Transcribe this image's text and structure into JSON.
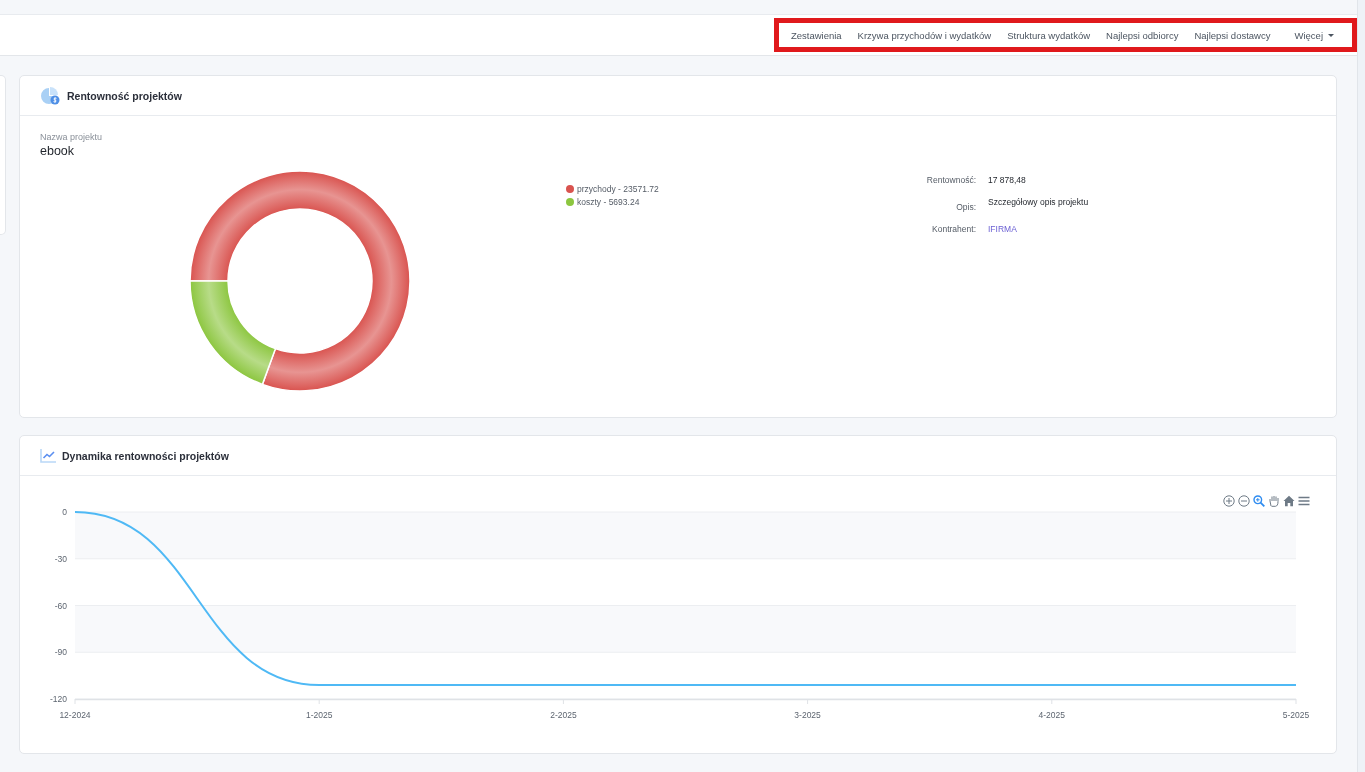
{
  "nav": {
    "highlighted": true,
    "items": [
      {
        "label": "Zestawienia",
        "dropdown": false
      },
      {
        "label": "Krzywa przychodów i wydatków",
        "dropdown": false
      },
      {
        "label": "Struktura wydatków",
        "dropdown": false
      },
      {
        "label": "Najlepsi odbiorcy",
        "dropdown": false
      },
      {
        "label": "Najlepsi dostawcy",
        "dropdown": false
      },
      {
        "label": "Więcej",
        "dropdown": true
      }
    ]
  },
  "profitability_card": {
    "title": "Rentowność projektów",
    "project_label": "Nazwa projektu",
    "project_name": "ebook",
    "legend": [
      {
        "label": "przychody - 23571.72",
        "color": "#d9534f"
      },
      {
        "label": "koszty - 5693.24",
        "color": "#8cc63f"
      }
    ],
    "chart_data": {
      "type": "donut",
      "values": [
        80.55,
        19.45
      ]
    },
    "details": [
      {
        "label": "Rentowność:",
        "value": "17 878,48",
        "kind": "text"
      },
      {
        "label": "Opis:",
        "value": "Szczegółowy opis projektu",
        "kind": "text"
      },
      {
        "label": "Kontrahent:",
        "value": "IFIRMA",
        "kind": "link"
      }
    ]
  },
  "dynamics_card": {
    "title": "Dynamika rentowności projektów",
    "toolbar": [
      {
        "kind": "zoom-in",
        "selected": false
      },
      {
        "kind": "zoom-out",
        "selected": false
      },
      {
        "kind": "zoom",
        "selected": true
      },
      {
        "kind": "pan",
        "selected": false
      },
      {
        "kind": "home",
        "selected": false
      },
      {
        "kind": "menu",
        "selected": false
      }
    ],
    "chart_data": {
      "type": "line",
      "categories": [
        "12-2024",
        "1-2025",
        "2-2025",
        "3-2025",
        "4-2025",
        "5-2025"
      ],
      "series": [
        {
          "color": "#4fb9f5",
          "values": [
            0,
            -111,
            -111,
            -111,
            -111,
            -111
          ]
        }
      ],
      "ylim": [
        -120,
        0
      ],
      "yticks": [
        0,
        -30,
        -60,
        -90,
        -120
      ],
      "grid": true
    }
  }
}
